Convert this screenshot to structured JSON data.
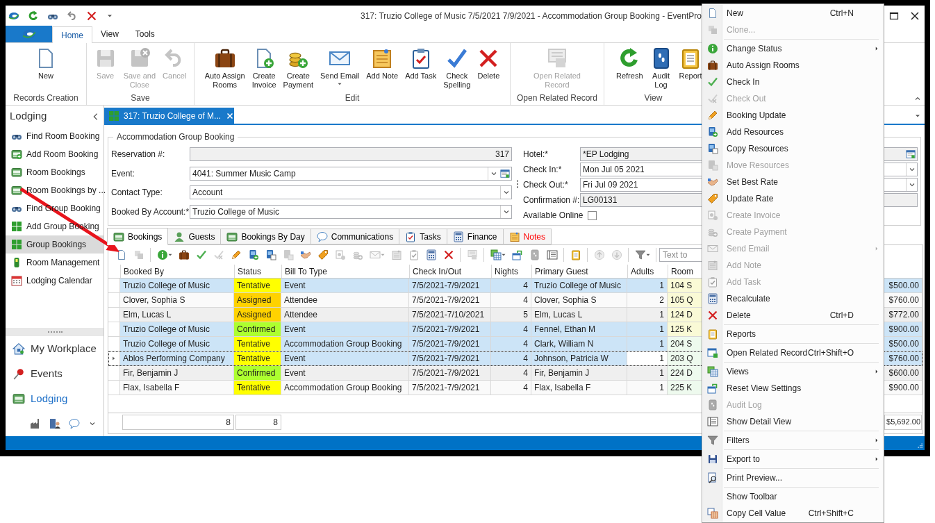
{
  "window": {
    "title": "317: Truzio College of Music 7/5/2021 7/9/2021 - Accommodation Group Booking - EventPro"
  },
  "ribbon": {
    "tabs": [
      {
        "label": "Home",
        "selected": true
      },
      {
        "label": "View",
        "selected": false
      },
      {
        "label": "Tools",
        "selected": false
      }
    ],
    "groups": [
      {
        "label": "Records Creation",
        "buttons": [
          {
            "label": "New",
            "disabled": false,
            "dropdown": false
          }
        ]
      },
      {
        "label": "Save",
        "buttons": [
          {
            "label": "Save",
            "disabled": true,
            "dropdown": false
          },
          {
            "label": "Save and\nClose",
            "disabled": true,
            "dropdown": false
          },
          {
            "label": "Cancel",
            "disabled": true,
            "dropdown": false
          }
        ]
      },
      {
        "label": "Edit",
        "buttons": [
          {
            "label": "Auto Assign\nRooms",
            "disabled": false,
            "dropdown": false
          },
          {
            "label": "Create\nInvoice",
            "disabled": false,
            "dropdown": false
          },
          {
            "label": "Create\nPayment",
            "disabled": false,
            "dropdown": false
          },
          {
            "label": "Send Email",
            "disabled": false,
            "dropdown": true
          },
          {
            "label": "Add Note",
            "disabled": false,
            "dropdown": false
          },
          {
            "label": "Add Task",
            "disabled": false,
            "dropdown": false
          },
          {
            "label": "Check\nSpelling",
            "disabled": false,
            "dropdown": false
          },
          {
            "label": "Delete",
            "disabled": false,
            "dropdown": false
          }
        ]
      },
      {
        "label": "Open Related Record",
        "buttons": [
          {
            "label": "Open Related\nRecord",
            "disabled": true,
            "dropdown": false
          }
        ]
      },
      {
        "label": "View",
        "buttons": [
          {
            "label": "Refresh",
            "disabled": false,
            "dropdown": false
          },
          {
            "label": "Audit\nLog",
            "disabled": false,
            "dropdown": false
          },
          {
            "label": "Report",
            "disabled": false,
            "dropdown": false
          }
        ]
      }
    ]
  },
  "sidebar": {
    "title": "Lodging",
    "items": [
      {
        "label": "Find Room Booking",
        "selected": false
      },
      {
        "label": "Add Room Booking",
        "selected": false
      },
      {
        "label": "Room Bookings",
        "selected": false
      },
      {
        "label": "Room Bookings by ...",
        "selected": false
      },
      {
        "label": "Find Group Booking",
        "selected": false
      },
      {
        "label": "Add Group Booking",
        "selected": false
      },
      {
        "label": "Group Bookings",
        "selected": true
      },
      {
        "label": "Room Management",
        "selected": false
      },
      {
        "label": "Lodging Calendar",
        "selected": false
      }
    ],
    "nav": [
      {
        "label": "My Workplace",
        "selected": false
      },
      {
        "label": "Events",
        "selected": false
      },
      {
        "label": "Lodging",
        "selected": true
      }
    ]
  },
  "document_tab": {
    "label": "317: Truzio College of M..."
  },
  "form": {
    "title": "Accommodation Group Booking",
    "left_fields": [
      {
        "label": "Reservation #:",
        "value": "317",
        "kind": "readonly_number"
      },
      {
        "label": "Event:",
        "value": "4041: Summer Music Camp",
        "kind": "lookup"
      },
      {
        "label": "Contact Type:",
        "value": "Account",
        "kind": "dropdown"
      },
      {
        "label": "Booked By Account:*",
        "value": "Truzio College of Music",
        "kind": "dropdown"
      }
    ],
    "right_fields": [
      {
        "label": "Hotel:*",
        "value": "*EP Lodging",
        "kind": "readonly_lookup"
      },
      {
        "label": "Check In:*",
        "value": "Mon Jul 05 2021",
        "kind": "dropdown"
      },
      {
        "label": "Check Out:*",
        "value": "Fri Jul 09 2021",
        "kind": "dropdown"
      },
      {
        "label": "Confirmation #:",
        "value": "LG00131",
        "kind": "readonly"
      },
      {
        "label": "Available Online",
        "checked": false,
        "kind": "checkbox"
      }
    ]
  },
  "detail_tabs": [
    {
      "label": "Bookings",
      "selected": true,
      "color": "#000000"
    },
    {
      "label": "Guests",
      "selected": false,
      "color": "#000000"
    },
    {
      "label": "Bookings By Day",
      "selected": false,
      "color": "#000000"
    },
    {
      "label": "Communications",
      "selected": false,
      "color": "#000000"
    },
    {
      "label": "Tasks",
      "selected": false,
      "color": "#000000"
    },
    {
      "label": "Finance",
      "selected": false,
      "color": "#000000"
    },
    {
      "label": "Notes",
      "selected": false,
      "color": "#ff0000"
    }
  ],
  "grid_toolbar": {
    "buttons": [
      {
        "disabled": false,
        "dropdown": false,
        "separator_before": false
      },
      {
        "disabled": true,
        "dropdown": false,
        "separator_before": false
      },
      {
        "disabled": false,
        "dropdown": true,
        "separator_before": true
      },
      {
        "disabled": false,
        "dropdown": false,
        "separator_before": false
      },
      {
        "disabled": false,
        "dropdown": false,
        "separator_before": false
      },
      {
        "disabled": true,
        "dropdown": false,
        "separator_before": false
      },
      {
        "disabled": false,
        "dropdown": false,
        "separator_before": false
      },
      {
        "disabled": false,
        "dropdown": false,
        "separator_before": false
      },
      {
        "disabled": false,
        "dropdown": false,
        "separator_before": false
      },
      {
        "disabled": true,
        "dropdown": false,
        "separator_before": false
      },
      {
        "disabled": false,
        "dropdown": false,
        "separator_before": false
      },
      {
        "disabled": false,
        "dropdown": false,
        "separator_before": false
      },
      {
        "disabled": true,
        "dropdown": false,
        "separator_before": false
      },
      {
        "disabled": true,
        "dropdown": false,
        "separator_before": false
      },
      {
        "disabled": true,
        "dropdown": true,
        "separator_before": false
      },
      {
        "disabled": true,
        "dropdown": false,
        "separator_before": false
      },
      {
        "disabled": true,
        "dropdown": false,
        "separator_before": false
      },
      {
        "disabled": false,
        "dropdown": false,
        "separator_before": false
      },
      {
        "disabled": false,
        "dropdown": false,
        "separator_before": false
      },
      {
        "disabled": true,
        "dropdown": false,
        "separator_before": true
      },
      {
        "disabled": false,
        "dropdown": true,
        "separator_before": true
      },
      {
        "disabled": false,
        "dropdown": false,
        "separator_before": false
      },
      {
        "disabled": true,
        "dropdown": false,
        "separator_before": false
      },
      {
        "disabled": false,
        "dropdown": false,
        "separator_before": false
      },
      {
        "disabled": false,
        "dropdown": false,
        "separator_before": true
      },
      {
        "disabled": true,
        "dropdown": false,
        "separator_before": true
      },
      {
        "disabled": true,
        "dropdown": false,
        "separator_before": false
      },
      {
        "disabled": false,
        "dropdown": true,
        "separator_before": true
      }
    ],
    "search_placeholder": "Text to"
  },
  "grid": {
    "columns": [
      "Booked By",
      "Status",
      "Bill To Type",
      "Check In/Out",
      "Nights",
      "Primary Guest",
      "Adults",
      "Room"
    ],
    "rows": [
      {
        "booked_by": "Truzio College of Music",
        "status": {
          "label": "Tentative",
          "color": "#ffff00"
        },
        "bill_to_type": "Event",
        "check_in_out": "7/5/2021-7/9/2021",
        "nights": "4",
        "primary_guest": "Truzio College of Music",
        "adults": "1",
        "room": {
          "label": "104 S",
          "color": "#fafad6"
        },
        "column_9": "$500.00",
        "selected": true,
        "focused": false
      },
      {
        "booked_by": "Clover, Sophia S",
        "status": {
          "label": "Assigned",
          "color": "#ffd200"
        },
        "bill_to_type": "Attendee",
        "check_in_out": "7/5/2021-7/9/2021",
        "nights": "4",
        "primary_guest": "Clover, Sophia S",
        "adults": "2",
        "room": {
          "label": "105 Q",
          "color": "#fafad6"
        },
        "column_9": "$760.00",
        "selected": false,
        "focused": false
      },
      {
        "booked_by": "Elm, Lucas L",
        "status": {
          "label": "Assigned",
          "color": "#ffd200"
        },
        "bill_to_type": "Attendee",
        "check_in_out": "7/5/2021-7/10/2021",
        "nights": "5",
        "primary_guest": "Elm, Lucas L",
        "adults": "1",
        "room": {
          "label": "124 D",
          "color": "#fafad6"
        },
        "column_9": "$772.00",
        "selected": false,
        "focused": false
      },
      {
        "booked_by": "Truzio College of Music",
        "status": {
          "label": "Confirmed",
          "color": "#adff2f"
        },
        "bill_to_type": "Event",
        "check_in_out": "7/5/2021-7/9/2021",
        "nights": "4",
        "primary_guest": "Fennel, Ethan M",
        "adults": "1",
        "room": {
          "label": "125 K",
          "color": "#fafad6"
        },
        "column_9": "$900.00",
        "selected": true,
        "focused": false
      },
      {
        "booked_by": "Truzio College of Music",
        "status": {
          "label": "Tentative",
          "color": "#ffff00"
        },
        "bill_to_type": "Accommodation Group Booking",
        "check_in_out": "7/5/2021-7/9/2021",
        "nights": "4",
        "primary_guest": "Clark, William N",
        "adults": "1",
        "room": {
          "label": "204 S",
          "color": "#eefaee"
        },
        "column_9": "$500.00",
        "selected": true,
        "focused": false
      },
      {
        "booked_by": "Ablos Performing Company",
        "status": {
          "label": "Tentative",
          "color": "#ffff00"
        },
        "bill_to_type": "Event",
        "check_in_out": "7/5/2021-7/9/2021",
        "nights": "4",
        "primary_guest": "Johnson, Patricia W",
        "adults": "1",
        "room": {
          "label": "203 Q",
          "color": "#eefaee"
        },
        "column_9": "$760.00",
        "selected": true,
        "focused": true
      },
      {
        "booked_by": "Fir, Benjamin J",
        "status": {
          "label": "Confirmed",
          "color": "#adff2f"
        },
        "bill_to_type": "Event",
        "check_in_out": "7/5/2021-7/9/2021",
        "nights": "4",
        "primary_guest": "Fir, Benjamin J",
        "adults": "1",
        "room": {
          "label": "224 D",
          "color": "#eefaee"
        },
        "column_9": "$600.00",
        "selected": false,
        "focused": false
      },
      {
        "booked_by": "Flax, Isabella F",
        "status": {
          "label": "Tentative",
          "color": "#ffff00"
        },
        "bill_to_type": "Accommodation Group Booking",
        "check_in_out": "7/5/2021-7/9/2021",
        "nights": "4",
        "primary_guest": "Flax, Isabella F",
        "adults": "1",
        "room": {
          "label": "225 K",
          "color": "#eefaee"
        },
        "column_9": "$900.00",
        "selected": false,
        "focused": false
      }
    ],
    "footer": {
      "booked_by": "8",
      "status": "8",
      "column_9": "$5,692.00"
    }
  },
  "context_menu": {
    "items": [
      {
        "label": "New",
        "shortcut": "Ctrl+N",
        "disabled": false,
        "submenu": false,
        "separator_before": false
      },
      {
        "label": "Clone...",
        "disabled": true,
        "submenu": false,
        "separator_before": false
      },
      {
        "label": "Change Status",
        "disabled": false,
        "submenu": true,
        "separator_before": true
      },
      {
        "label": "Auto Assign Rooms",
        "disabled": false,
        "submenu": false,
        "separator_before": false
      },
      {
        "label": "Check In",
        "disabled": false,
        "submenu": false,
        "separator_before": false
      },
      {
        "label": "Check Out",
        "disabled": true,
        "submenu": false,
        "separator_before": false
      },
      {
        "label": "Booking Update",
        "disabled": false,
        "submenu": false,
        "separator_before": false
      },
      {
        "label": "Add Resources",
        "disabled": false,
        "submenu": false,
        "separator_before": false
      },
      {
        "label": "Copy Resources",
        "disabled": false,
        "submenu": false,
        "separator_before": false
      },
      {
        "label": "Move Resources",
        "disabled": true,
        "submenu": false,
        "separator_before": false
      },
      {
        "label": "Set Best Rate",
        "disabled": false,
        "submenu": false,
        "separator_before": false
      },
      {
        "label": "Update Rate",
        "disabled": false,
        "submenu": false,
        "separator_before": false
      },
      {
        "label": "Create Invoice",
        "disabled": true,
        "submenu": false,
        "separator_before": false
      },
      {
        "label": "Create Payment",
        "disabled": true,
        "submenu": false,
        "separator_before": false
      },
      {
        "label": "Send Email",
        "disabled": true,
        "submenu": true,
        "separator_before": false
      },
      {
        "label": "Add Note",
        "disabled": true,
        "submenu": false,
        "separator_before": false
      },
      {
        "label": "Add Task",
        "disabled": true,
        "submenu": false,
        "separator_before": false
      },
      {
        "label": "Recalculate",
        "disabled": false,
        "submenu": false,
        "separator_before": false
      },
      {
        "label": "Delete",
        "shortcut": "Ctrl+D",
        "disabled": false,
        "submenu": false,
        "separator_before": false
      },
      {
        "label": "Reports",
        "disabled": false,
        "submenu": false,
        "separator_before": true
      },
      {
        "label": "Open Related Record",
        "shortcut": "Ctrl+Shift+O",
        "disabled": false,
        "submenu": false,
        "separator_before": true
      },
      {
        "label": "Views",
        "disabled": false,
        "submenu": true,
        "separator_before": true
      },
      {
        "label": "Reset View Settings",
        "disabled": false,
        "submenu": false,
        "separator_before": false
      },
      {
        "label": "Audit Log",
        "disabled": true,
        "submenu": false,
        "separator_before": false
      },
      {
        "label": "Show Detail View",
        "disabled": false,
        "submenu": false,
        "separator_before": false
      },
      {
        "label": "Filters",
        "disabled": false,
        "submenu": true,
        "separator_before": true
      },
      {
        "label": "Export to",
        "disabled": false,
        "submenu": true,
        "separator_before": true
      },
      {
        "label": "Print Preview...",
        "disabled": false,
        "submenu": false,
        "separator_before": true
      },
      {
        "label": "Show Toolbar",
        "disabled": false,
        "submenu": false,
        "separator_before": true
      },
      {
        "label": "Copy Cell Value",
        "shortcut": "Ctrl+Shift+C",
        "disabled": false,
        "submenu": false,
        "separator_before": false
      }
    ]
  }
}
